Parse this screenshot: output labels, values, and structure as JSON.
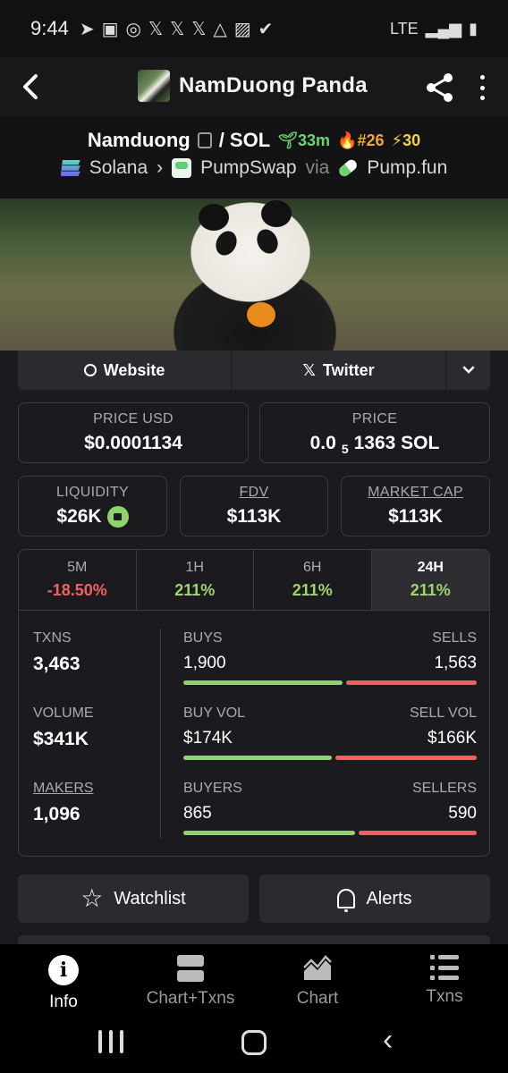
{
  "status": {
    "time": "9:44",
    "network": "LTE"
  },
  "appbar": {
    "title": "NamDuong Panda"
  },
  "token": {
    "name": "Namduong",
    "quote": "/ SOL",
    "age": "33m",
    "rank": "#26",
    "boosts": "30",
    "chain": "Solana",
    "dex": "PumpSwap",
    "via": "via",
    "launchpad": "Pump.fun"
  },
  "links": {
    "website": "Website",
    "twitter": "Twitter"
  },
  "prices": {
    "usd_label": "PRICE USD",
    "usd_value": "$0.0001134",
    "native_label": "PRICE",
    "native_prefix": "0.0",
    "native_zeros": "5",
    "native_rest": "1363 SOL"
  },
  "metrics": {
    "liquidity_label": "LIQUIDITY",
    "liquidity_value": "$26K",
    "fdv_label": "FDV",
    "fdv_value": "$113K",
    "mcap_label": "MARKET CAP",
    "mcap_value": "$113K"
  },
  "timeframes": [
    {
      "label": "5M",
      "change": "-18.50%"
    },
    {
      "label": "1H",
      "change": "211%"
    },
    {
      "label": "6H",
      "change": "211%"
    },
    {
      "label": "24H",
      "change": "211%"
    }
  ],
  "stats": {
    "txns_label": "TXNS",
    "txns": "3,463",
    "buys_label": "BUYS",
    "buys": "1,900",
    "sells_label": "SELLS",
    "sells": "1,563",
    "buys_ratio": 0.549,
    "volume_label": "VOLUME",
    "volume": "$341K",
    "buyvol_label": "BUY VOL",
    "buyvol": "$174K",
    "sellvol_label": "SELL VOL",
    "sellvol": "$166K",
    "buyvol_ratio": 0.512,
    "makers_label": "MAKERS",
    "makers": "1,096",
    "buyers_label": "BUYERS",
    "buyers": "865",
    "sellers_label": "SELLERS",
    "sellers": "590",
    "buyers_ratio": 0.594
  },
  "actions": {
    "watchlist": "Watchlist",
    "alerts": "Alerts"
  },
  "bottom_nav": [
    {
      "label": "Info",
      "icon": "info-icon",
      "active": true
    },
    {
      "label": "Chart+Txns",
      "icon": "chart-txns-icon"
    },
    {
      "label": "Chart",
      "icon": "chart-icon"
    },
    {
      "label": "Txns",
      "icon": "list-icon"
    }
  ],
  "colors": {
    "positive": "#9fd46b",
    "negative": "#f06262",
    "age": "#6cd46c",
    "rank": "#f2a63a"
  }
}
